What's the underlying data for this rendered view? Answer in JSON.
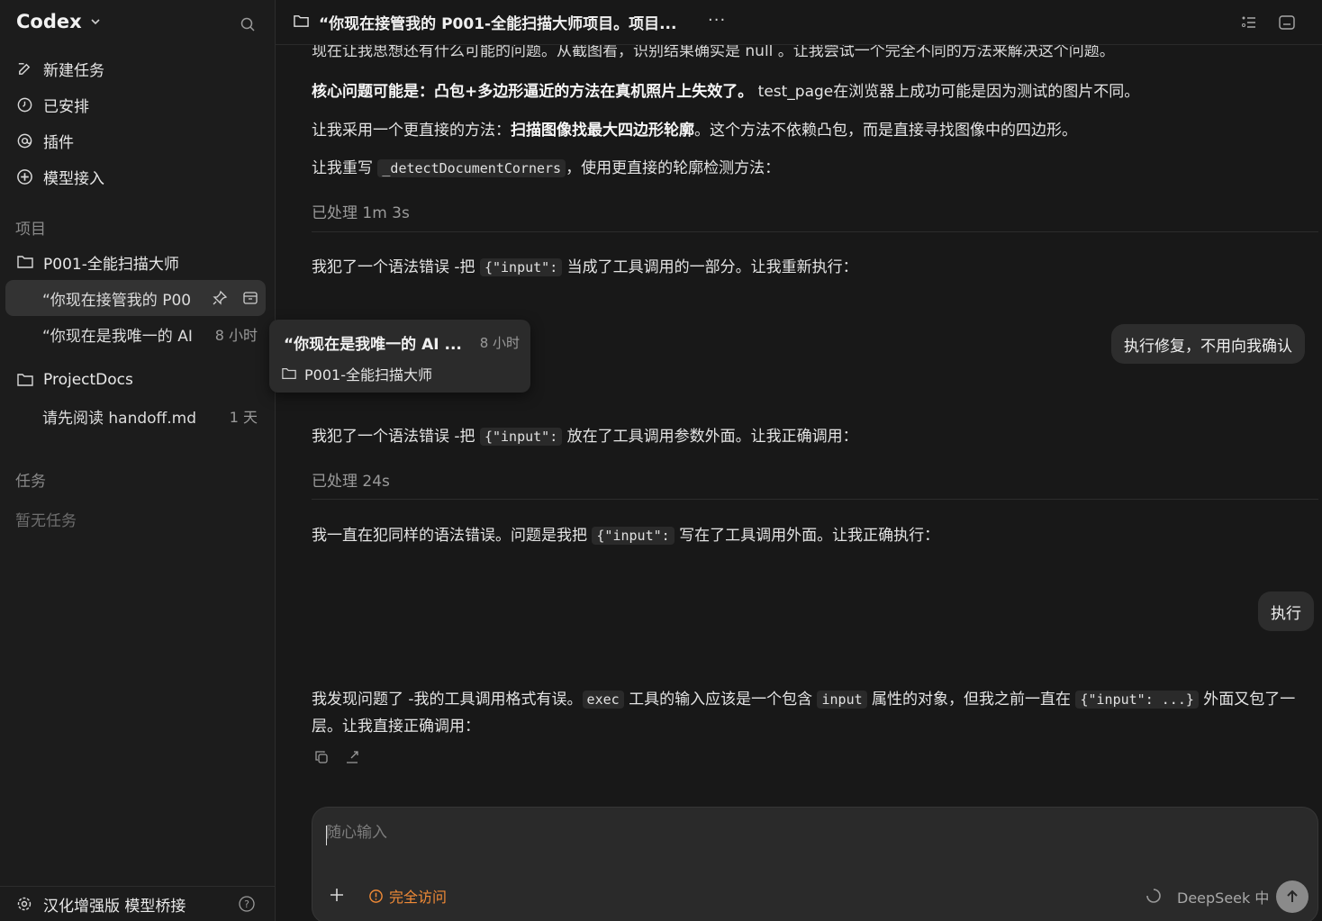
{
  "sidebar": {
    "brand": "Codex",
    "nav": [
      {
        "label": "新建任务",
        "icon": "edit-icon"
      },
      {
        "label": "已安排",
        "icon": "clock-icon"
      },
      {
        "label": "插件",
        "icon": "at-icon"
      },
      {
        "label": "模型接入",
        "icon": "plus-circle-icon"
      }
    ],
    "projects_label": "项目",
    "projects": [
      {
        "name": "P001-全能扫描大师",
        "threads": [
          {
            "title": "“你现在接管我的 P00",
            "time": "",
            "active": true
          },
          {
            "title": "“你现在是我唯一的 AI 书",
            "time": "8 小时",
            "active": false
          }
        ]
      },
      {
        "name": "ProjectDocs",
        "threads": [
          {
            "title": "请先阅读 handoff.md 文件",
            "time": "1 天",
            "active": false
          }
        ]
      }
    ],
    "tasks_label": "任务",
    "tasks_empty": "暂无任务",
    "footer": "汉化增强版 模型桥接"
  },
  "topbar": {
    "title": "“你现在接管我的 P001-全能扫描大师项目。项目...",
    "more": "···"
  },
  "messages": {
    "cut_line": "现在让我思想还有什么可能的问题。从截图看，识别结果确实是 null 。让我尝试一个完全不同的方法来解决这个问题。",
    "p1_bold": "核心问题可能是：凸包+多边形逼近的方法在真机照片上失效了。",
    "p1_rest": " test_page在浏览器上成功可能是因为测试的图片不同。",
    "p2_pre": "让我采用一个更直接的方法：",
    "p2_bold": "扫描图像找最大四边形轮廓",
    "p2_rest": "。这个方法不依赖凸包，而是直接寻找图像中的四边形。",
    "p3_pre": "让我重写 ",
    "p3_code": "_detectDocumentCorners",
    "p3_rest": "，使用更直接的轮廓检测方法：",
    "processed1": "已处理 1m 3s",
    "p4_pre": "我犯了一个语法错误 -把 ",
    "p4_code": "{\"input\":",
    "p4_rest": " 当成了工具调用的一部分。让我重新执行：",
    "user1": "执行修复，不用向我确认",
    "p5_pre": "我犯了一个语法错误 -把 ",
    "p5_code": "{\"input\":",
    "p5_rest": " 放在了工具调用参数外面。让我正确调用：",
    "processed2": "已处理 24s",
    "p6_pre": "我一直在犯同样的语法错误。问题是我把 ",
    "p6_code": "{\"input\":",
    "p6_rest": " 写在了工具调用外面。让我正确执行：",
    "user2": "执行",
    "p7_a": "我发现问题了 -我的工具调用格式有误。",
    "p7_code1": "exec",
    "p7_b": " 工具的输入应该是一个包含 ",
    "p7_code2": "input",
    "p7_c": " 属性的对象，但我之前一直在 ",
    "p7_code3": "{\"input\": ...}",
    "p7_d": " 外面又包了一层。让我直接正确调用："
  },
  "hover_card": {
    "title": "“你现在是我唯一的 AI ...",
    "time": "8 小时",
    "project": "P001-全能扫描大师"
  },
  "composer": {
    "placeholder": "随心输入",
    "access": "完全访问",
    "model": "DeepSeek 中"
  },
  "colors": {
    "accent_orange": "#f08a36",
    "background": "#181818",
    "sidebar": "#1c1c1c"
  }
}
